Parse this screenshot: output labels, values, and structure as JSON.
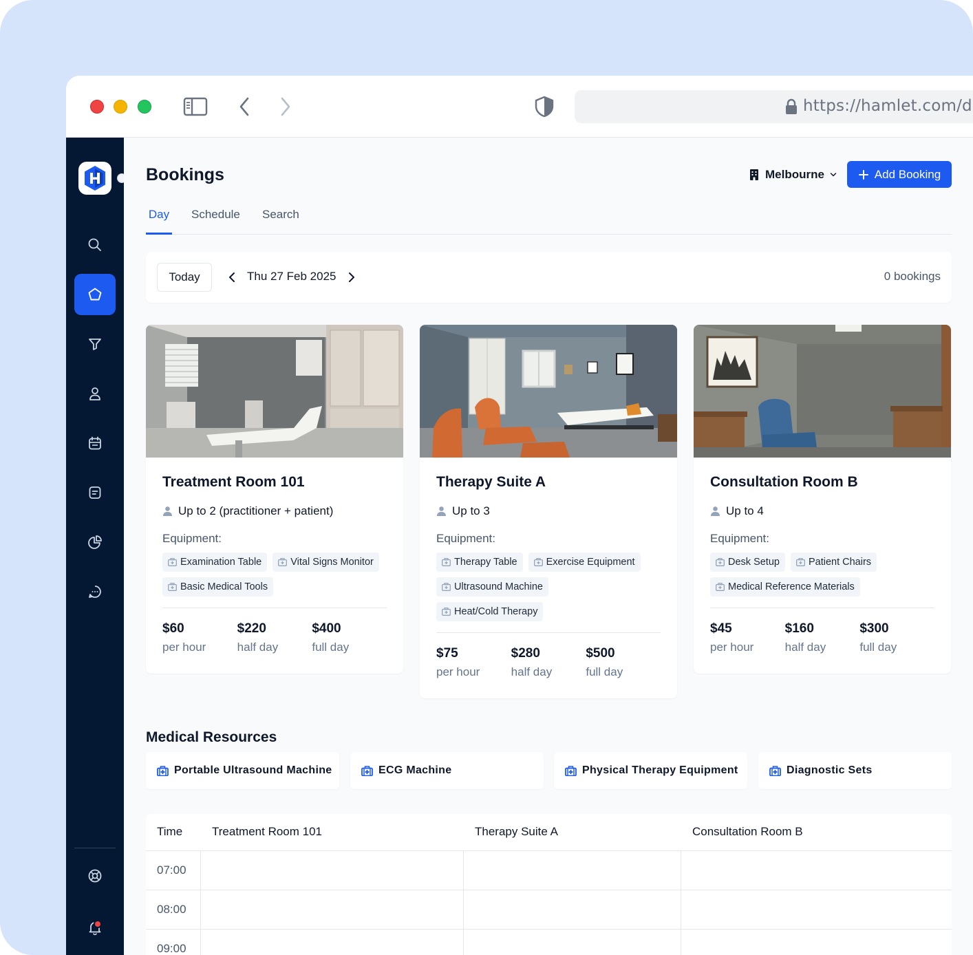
{
  "browser": {
    "url": "https://hamlet.com/das"
  },
  "sidebar": {
    "logo_letter": "H",
    "items": [
      {
        "icon": "search-icon"
      },
      {
        "icon": "home-icon",
        "active": true
      },
      {
        "icon": "filter-icon"
      },
      {
        "icon": "user-icon"
      },
      {
        "icon": "calendar-icon"
      },
      {
        "icon": "document-icon"
      },
      {
        "icon": "pie-chart-icon"
      },
      {
        "icon": "chat-icon"
      },
      {
        "icon": "support-icon"
      },
      {
        "icon": "bell-icon"
      }
    ]
  },
  "header": {
    "title": "Bookings",
    "location": "Melbourne",
    "add_button": "Add Booking"
  },
  "tabs": [
    {
      "label": "Day",
      "active": true
    },
    {
      "label": "Schedule"
    },
    {
      "label": "Search"
    }
  ],
  "datebar": {
    "today": "Today",
    "date": "Thu 27 Feb 2025",
    "count": "0 bookings"
  },
  "rooms": [
    {
      "name": "Treatment Room 101",
      "capacity": "Up to 2 (practitioner + patient)",
      "equipment_label": "Equipment:",
      "equipment": [
        "Examination Table",
        "Vital Signs Monitor",
        "Basic Medical Tools"
      ],
      "prices": [
        {
          "value": "$60",
          "unit": "per hour"
        },
        {
          "value": "$220",
          "unit": "half day"
        },
        {
          "value": "$400",
          "unit": "full day"
        }
      ]
    },
    {
      "name": "Therapy Suite A",
      "capacity": "Up to 3",
      "equipment_label": "Equipment:",
      "equipment": [
        "Therapy Table",
        "Exercise Equipment",
        "Ultrasound Machine",
        "Heat/Cold Therapy"
      ],
      "prices": [
        {
          "value": "$75",
          "unit": "per hour"
        },
        {
          "value": "$280",
          "unit": "half day"
        },
        {
          "value": "$500",
          "unit": "full day"
        }
      ]
    },
    {
      "name": "Consultation Room B",
      "capacity": "Up to 4",
      "equipment_label": "Equipment:",
      "equipment": [
        "Desk Setup",
        "Patient Chairs",
        "Medical Reference Materials"
      ],
      "prices": [
        {
          "value": "$45",
          "unit": "per hour"
        },
        {
          "value": "$160",
          "unit": "half day"
        },
        {
          "value": "$300",
          "unit": "full day"
        }
      ]
    }
  ],
  "resources": {
    "title": "Medical Resources",
    "items": [
      "Portable Ultrasound Machine",
      "ECG Machine",
      "Physical Therapy Equipment",
      "Diagnostic Sets"
    ]
  },
  "schedule": {
    "headers": [
      "Time",
      "Treatment Room 101",
      "Therapy Suite A",
      "Consultation Room B"
    ],
    "times": [
      "07:00",
      "08:00",
      "09:00"
    ]
  },
  "colors": {
    "accent": "#1d5bf0",
    "sidebar": "#041833",
    "background": "#d6e4fb"
  }
}
